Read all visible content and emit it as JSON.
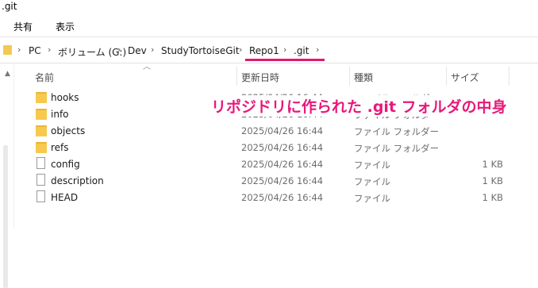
{
  "window": {
    "title": ".git"
  },
  "ribbon": {
    "tabs": [
      "共有",
      "表示"
    ]
  },
  "address": {
    "crumbs": [
      "PC",
      "ボリューム (G:)",
      "Dev",
      "StudyTortoiseGit",
      "Repo1",
      ".git"
    ]
  },
  "columns": {
    "name": "名前",
    "modified": "更新日時",
    "type": "種類",
    "size": "サイズ"
  },
  "files": [
    {
      "name": "hooks",
      "kind": "folder",
      "modified": "2025/04/26 16:44",
      "type": "ファイル フォルダー",
      "size": ""
    },
    {
      "name": "info",
      "kind": "folder",
      "modified": "2025/04/26 16:44",
      "type": "ファイル フォルダー",
      "size": ""
    },
    {
      "name": "objects",
      "kind": "folder",
      "modified": "2025/04/26 16:44",
      "type": "ファイル フォルダー",
      "size": ""
    },
    {
      "name": "refs",
      "kind": "folder",
      "modified": "2025/04/26 16:44",
      "type": "ファイル フォルダー",
      "size": ""
    },
    {
      "name": "config",
      "kind": "file",
      "modified": "2025/04/26 16:44",
      "type": "ファイル",
      "size": "1 KB"
    },
    {
      "name": "description",
      "kind": "file",
      "modified": "2025/04/26 16:44",
      "type": "ファイル",
      "size": "1 KB"
    },
    {
      "name": "HEAD",
      "kind": "file",
      "modified": "2025/04/26 16:44",
      "type": "ファイル",
      "size": "1 KB"
    }
  ],
  "annotation": {
    "text": "リポジドリに作られた .git フォルダの中身",
    "color": "#e8187a"
  },
  "colors": {
    "folder": "#f7c94c",
    "highlight": "#e0186c"
  }
}
